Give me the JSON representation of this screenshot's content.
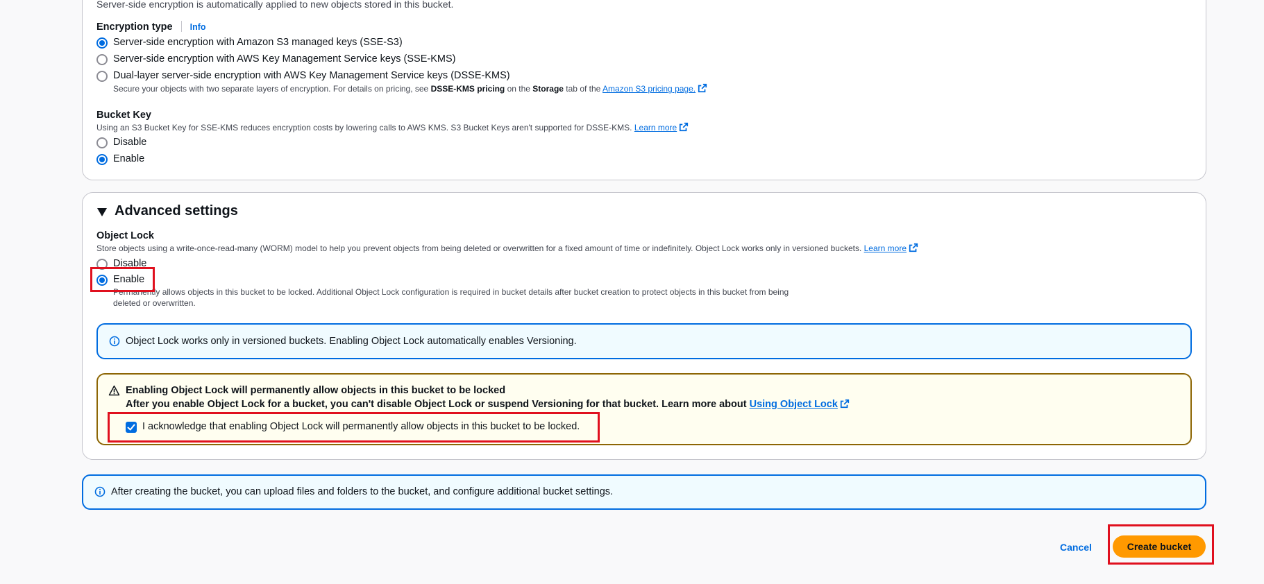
{
  "encryption": {
    "intro_text": "Server-side encryption is automatically applied to new objects stored in this bucket.",
    "type_label": "Encryption type",
    "info_label": "Info",
    "options": [
      "Server-side encryption with Amazon S3 managed keys (SSE-S3)",
      "Server-side encryption with AWS Key Management Service keys (SSE-KMS)",
      "Dual-layer server-side encryption with AWS Key Management Service keys (DSSE-KMS)"
    ],
    "selected_index": 0,
    "dsse_desc_1": "Secure your objects with two separate layers of encryption. For details on pricing, see ",
    "dsse_desc_bold_1": "DSSE-KMS pricing",
    "dsse_desc_2": " on the ",
    "dsse_desc_bold_2": "Storage",
    "dsse_desc_3": " tab of the ",
    "dsse_link": "Amazon S3 pricing page."
  },
  "bucket_key": {
    "label": "Bucket Key",
    "description": "Using an S3 Bucket Key for SSE-KMS reduces encryption costs by lowering calls to AWS KMS. S3 Bucket Keys aren't supported for DSSE-KMS. ",
    "learn_more": "Learn more",
    "options": [
      "Disable",
      "Enable"
    ],
    "selected_index": 1
  },
  "advanced": {
    "title": "Advanced settings",
    "object_lock_label": "Object Lock",
    "object_lock_desc": "Store objects using a write-once-read-many (WORM) model to help you prevent objects from being deleted or overwritten for a fixed amount of time or indefinitely. Object Lock works only in versioned buckets. ",
    "learn_more": "Learn more",
    "options": [
      "Disable",
      "Enable"
    ],
    "selected_index": 1,
    "enable_desc_line1": "Permanently allows objects in this bucket to be locked. Additional Object Lock configuration is required in bucket details after bucket creation to protect objects in this bucket from being",
    "enable_desc_line2": "deleted or overwritten.",
    "info_alert": "Object Lock works only in versioned buckets. Enabling Object Lock automatically enables Versioning.",
    "warning_title": "Enabling Object Lock will permanently allow objects in this bucket to be locked",
    "warning_body": "After you enable Object Lock for a bucket, you can't disable Object Lock or suspend Versioning for that bucket. Learn more about ",
    "warning_link": "Using Object Lock",
    "acknowledge_label": "I acknowledge that enabling Object Lock will permanently allow objects in this bucket to be locked.",
    "acknowledged": true
  },
  "footer_info": "After creating the bucket, you can upload files and folders to the bucket, and configure additional bucket settings.",
  "actions": {
    "cancel": "Cancel",
    "create": "Create bucket"
  },
  "colors": {
    "accent": "#006ce0",
    "primary_button": "#ff9900",
    "highlight": "#e0101e",
    "warning_border": "#8d6605"
  }
}
